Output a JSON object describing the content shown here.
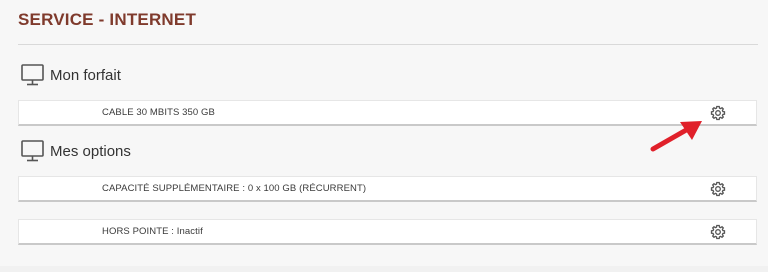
{
  "page": {
    "title": "SERVICE - INTERNET"
  },
  "sections": [
    {
      "title": "Mon forfait",
      "icon": "monitor-icon",
      "rows": [
        {
          "label": "CABLE 30 MBITS 350 GB",
          "action_icon": "gear-icon"
        }
      ]
    },
    {
      "title": "Mes options",
      "icon": "monitor-icon",
      "rows": [
        {
          "label": "CAPACITÉ SUPPLÉMENTAIRE : 0 x 100 GB (RÉCURRENT)",
          "action_icon": "gear-icon"
        },
        {
          "label": "HORS POINTE : Inactif",
          "action_icon": "gear-icon"
        }
      ]
    }
  ],
  "colors": {
    "title": "#7f3a2c",
    "arrow": "#e0202a",
    "icon": "#555555"
  }
}
